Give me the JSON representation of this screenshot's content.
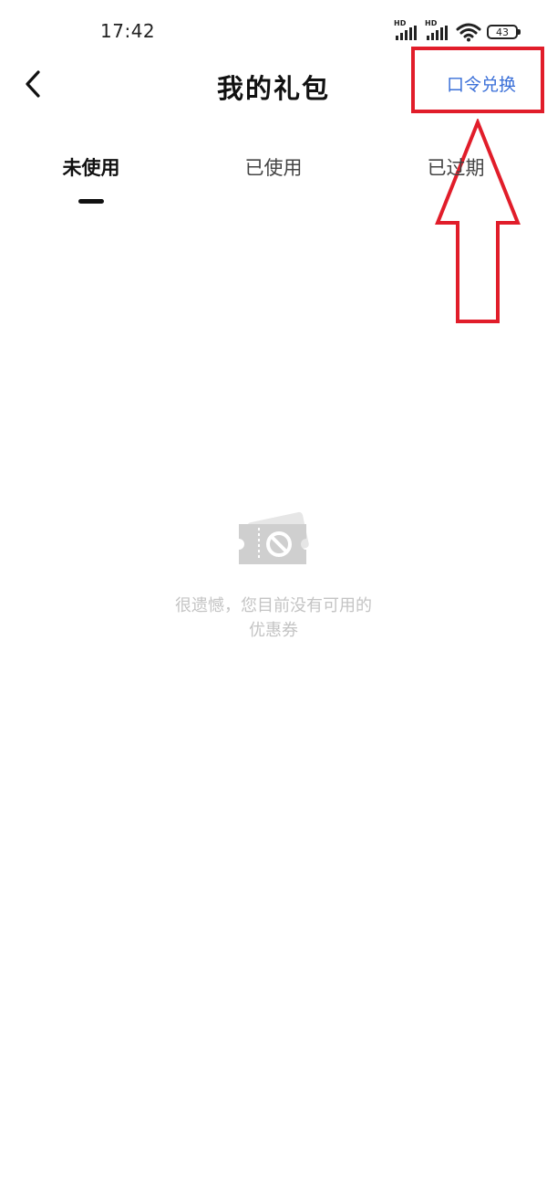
{
  "status_bar": {
    "time": "17:42",
    "network_badge": "HD",
    "battery_level": "43",
    "icons": [
      "signal-icon",
      "signal-icon",
      "wifi-icon",
      "battery-icon"
    ]
  },
  "header": {
    "title": "我的礼包",
    "redeem_label": "口令兑换",
    "back_icon": "back-chevron-icon",
    "accent_color": "#3a6fd8"
  },
  "annotation": {
    "color": "#e11d2a"
  },
  "tabs": [
    {
      "label": "未使用",
      "active": true
    },
    {
      "label": "已使用",
      "active": false
    },
    {
      "label": "已过期",
      "active": false
    }
  ],
  "empty_state": {
    "icon": "ticket-disabled-icon",
    "message": "很遗憾，您目前没有可用的优惠券"
  }
}
